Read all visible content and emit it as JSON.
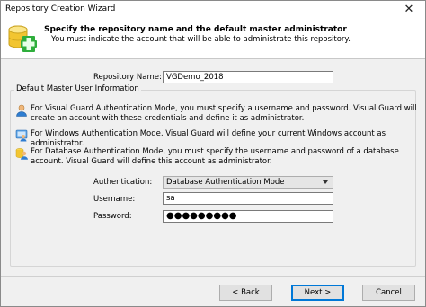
{
  "window": {
    "title": "Repository Creation Wizard"
  },
  "header": {
    "title": "Specify the repository name and the default master administrator",
    "subtitle": "You must indicate the account that will be able to administrate this repository."
  },
  "repository": {
    "label": "Repository Name:",
    "value": "VGDemo_2018"
  },
  "group": {
    "legend": "Default Master User Information",
    "info": [
      {
        "icon": "user-icon",
        "text": "For Visual Guard Authentication Mode, you must specify a username and password. Visual Guard will create an account with these credentials and define it as administrator."
      },
      {
        "icon": "windows-user-icon",
        "text": "For Windows Authentication Mode, Visual Guard will define your current Windows account as administrator."
      },
      {
        "icon": "database-user-icon",
        "text": "For Database Authentication Mode, you must specify the username and password of a database account. Visual Guard will define this account as administrator."
      }
    ],
    "authentication": {
      "label": "Authentication:",
      "value": "Database Authentication Mode"
    },
    "username": {
      "label": "Username:",
      "value": "sa"
    },
    "password": {
      "label": "Password:",
      "value": "●●●●●●●●●"
    }
  },
  "footer": {
    "back": "< Back",
    "next": "Next >",
    "cancel": "Cancel"
  }
}
